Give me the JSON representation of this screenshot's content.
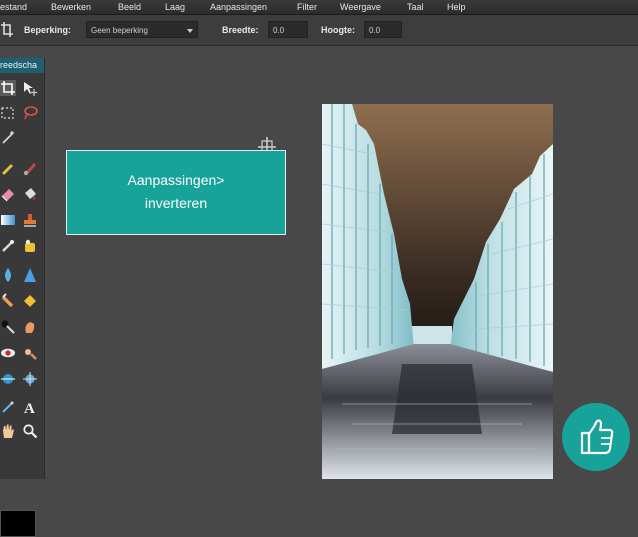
{
  "menubar": {
    "items": [
      "estand",
      "Bewerken",
      "Beeld",
      "Laag",
      "Aanpassingen",
      "Filter",
      "Weergave",
      "Taal",
      "Help"
    ]
  },
  "options": {
    "beperking_label": "Beperking:",
    "beperking_value": "Geen beperking",
    "breedte_label": "Breedte:",
    "breedte_value": "0.0",
    "hoogte_label": "Hoogte:",
    "hoogte_value": "0.0"
  },
  "toolbox": {
    "title": "reedscha",
    "tools": [
      "crop-icon",
      "move-icon",
      "marquee-icon",
      "lasso-icon",
      "wand-icon",
      "pencil-icon",
      "brush-icon",
      "eraser-icon",
      "bucket-icon",
      "gradient-icon",
      "stamp-icon",
      "healing-icon",
      "color-replace-icon",
      "drop-icon",
      "sharpen-icon",
      "smudge-icon",
      "sponge-icon",
      "dodge-icon",
      "burn-icon",
      "red-eye-icon",
      "bloat-icon",
      "pinch-icon",
      "spherize-icon",
      "picker-icon",
      "text-icon",
      "hand-icon",
      "zoom-icon"
    ]
  },
  "callout": {
    "line1": "Aanpassingen>",
    "line2": "inverteren"
  },
  "colors": {
    "accent": "#17a39a",
    "workspace": "#484848",
    "panel": "#393939"
  }
}
